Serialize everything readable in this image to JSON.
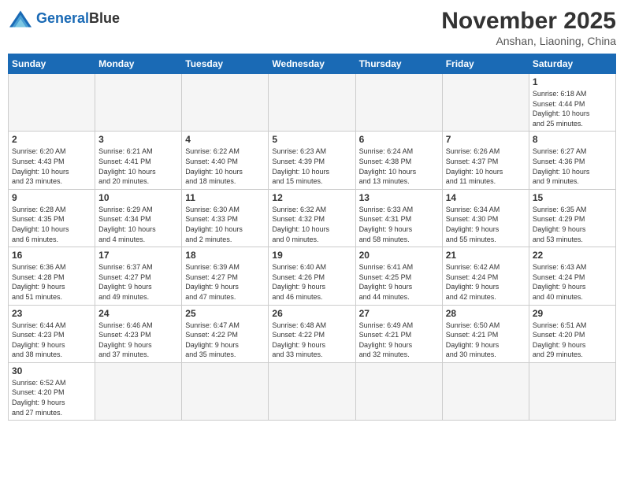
{
  "header": {
    "logo_general": "General",
    "logo_blue": "Blue",
    "month_year": "November 2025",
    "location": "Anshan, Liaoning, China"
  },
  "weekdays": [
    "Sunday",
    "Monday",
    "Tuesday",
    "Wednesday",
    "Thursday",
    "Friday",
    "Saturday"
  ],
  "weeks": [
    [
      {
        "day": "",
        "empty": true
      },
      {
        "day": "",
        "empty": true
      },
      {
        "day": "",
        "empty": true
      },
      {
        "day": "",
        "empty": true
      },
      {
        "day": "",
        "empty": true
      },
      {
        "day": "",
        "empty": true
      },
      {
        "day": "1",
        "info": "Sunrise: 6:18 AM\nSunset: 4:44 PM\nDaylight: 10 hours\nand 25 minutes."
      }
    ],
    [
      {
        "day": "2",
        "info": "Sunrise: 6:20 AM\nSunset: 4:43 PM\nDaylight: 10 hours\nand 23 minutes."
      },
      {
        "day": "3",
        "info": "Sunrise: 6:21 AM\nSunset: 4:41 PM\nDaylight: 10 hours\nand 20 minutes."
      },
      {
        "day": "4",
        "info": "Sunrise: 6:22 AM\nSunset: 4:40 PM\nDaylight: 10 hours\nand 18 minutes."
      },
      {
        "day": "5",
        "info": "Sunrise: 6:23 AM\nSunset: 4:39 PM\nDaylight: 10 hours\nand 15 minutes."
      },
      {
        "day": "6",
        "info": "Sunrise: 6:24 AM\nSunset: 4:38 PM\nDaylight: 10 hours\nand 13 minutes."
      },
      {
        "day": "7",
        "info": "Sunrise: 6:26 AM\nSunset: 4:37 PM\nDaylight: 10 hours\nand 11 minutes."
      },
      {
        "day": "8",
        "info": "Sunrise: 6:27 AM\nSunset: 4:36 PM\nDaylight: 10 hours\nand 9 minutes."
      }
    ],
    [
      {
        "day": "9",
        "info": "Sunrise: 6:28 AM\nSunset: 4:35 PM\nDaylight: 10 hours\nand 6 minutes."
      },
      {
        "day": "10",
        "info": "Sunrise: 6:29 AM\nSunset: 4:34 PM\nDaylight: 10 hours\nand 4 minutes."
      },
      {
        "day": "11",
        "info": "Sunrise: 6:30 AM\nSunset: 4:33 PM\nDaylight: 10 hours\nand 2 minutes."
      },
      {
        "day": "12",
        "info": "Sunrise: 6:32 AM\nSunset: 4:32 PM\nDaylight: 10 hours\nand 0 minutes."
      },
      {
        "day": "13",
        "info": "Sunrise: 6:33 AM\nSunset: 4:31 PM\nDaylight: 9 hours\nand 58 minutes."
      },
      {
        "day": "14",
        "info": "Sunrise: 6:34 AM\nSunset: 4:30 PM\nDaylight: 9 hours\nand 55 minutes."
      },
      {
        "day": "15",
        "info": "Sunrise: 6:35 AM\nSunset: 4:29 PM\nDaylight: 9 hours\nand 53 minutes."
      }
    ],
    [
      {
        "day": "16",
        "info": "Sunrise: 6:36 AM\nSunset: 4:28 PM\nDaylight: 9 hours\nand 51 minutes."
      },
      {
        "day": "17",
        "info": "Sunrise: 6:37 AM\nSunset: 4:27 PM\nDaylight: 9 hours\nand 49 minutes."
      },
      {
        "day": "18",
        "info": "Sunrise: 6:39 AM\nSunset: 4:27 PM\nDaylight: 9 hours\nand 47 minutes."
      },
      {
        "day": "19",
        "info": "Sunrise: 6:40 AM\nSunset: 4:26 PM\nDaylight: 9 hours\nand 46 minutes."
      },
      {
        "day": "20",
        "info": "Sunrise: 6:41 AM\nSunset: 4:25 PM\nDaylight: 9 hours\nand 44 minutes."
      },
      {
        "day": "21",
        "info": "Sunrise: 6:42 AM\nSunset: 4:24 PM\nDaylight: 9 hours\nand 42 minutes."
      },
      {
        "day": "22",
        "info": "Sunrise: 6:43 AM\nSunset: 4:24 PM\nDaylight: 9 hours\nand 40 minutes."
      }
    ],
    [
      {
        "day": "23",
        "info": "Sunrise: 6:44 AM\nSunset: 4:23 PM\nDaylight: 9 hours\nand 38 minutes."
      },
      {
        "day": "24",
        "info": "Sunrise: 6:46 AM\nSunset: 4:23 PM\nDaylight: 9 hours\nand 37 minutes."
      },
      {
        "day": "25",
        "info": "Sunrise: 6:47 AM\nSunset: 4:22 PM\nDaylight: 9 hours\nand 35 minutes."
      },
      {
        "day": "26",
        "info": "Sunrise: 6:48 AM\nSunset: 4:22 PM\nDaylight: 9 hours\nand 33 minutes."
      },
      {
        "day": "27",
        "info": "Sunrise: 6:49 AM\nSunset: 4:21 PM\nDaylight: 9 hours\nand 32 minutes."
      },
      {
        "day": "28",
        "info": "Sunrise: 6:50 AM\nSunset: 4:21 PM\nDaylight: 9 hours\nand 30 minutes."
      },
      {
        "day": "29",
        "info": "Sunrise: 6:51 AM\nSunset: 4:20 PM\nDaylight: 9 hours\nand 29 minutes."
      }
    ],
    [
      {
        "day": "30",
        "info": "Sunrise: 6:52 AM\nSunset: 4:20 PM\nDaylight: 9 hours\nand 27 minutes.",
        "last": true
      },
      {
        "day": "",
        "empty": true,
        "last": true
      },
      {
        "day": "",
        "empty": true,
        "last": true
      },
      {
        "day": "",
        "empty": true,
        "last": true
      },
      {
        "day": "",
        "empty": true,
        "last": true
      },
      {
        "day": "",
        "empty": true,
        "last": true
      },
      {
        "day": "",
        "empty": true,
        "last": true
      }
    ]
  ]
}
